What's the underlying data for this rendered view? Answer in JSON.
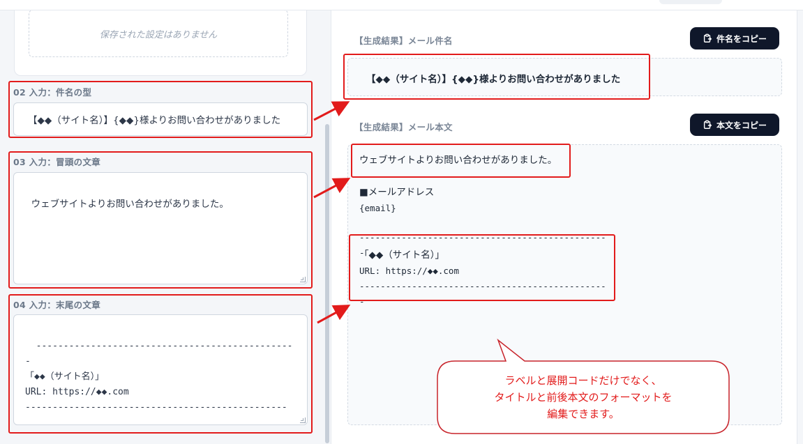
{
  "left": {
    "saved_empty": "保存された設定はありません",
    "fields": [
      {
        "label": "02 入力：件名の型",
        "value": "【◆◆（サイト名）】{◆◆}様よりお問い合わせがありました"
      },
      {
        "label": "03 入力：冒頭の文章",
        "value": "ウェブサイトよりお問い合わせがありました。"
      },
      {
        "label": "04 入力：末尾の文章",
        "value": "------------------------------------------------\n「◆◆（サイト名）」\nURL: https://◆◆.com\n------------------------------------------------"
      }
    ]
  },
  "right": {
    "subject_label": "【生成結果】メール件名",
    "subject_copy": "件名をコピー",
    "subject_value": "【◆◆（サイト名）】{◆◆}様よりお問い合わせがありました",
    "body_label": "【生成結果】メール本文",
    "body_copy": "本文をコピー",
    "body_intro": "ウェブサイトよりお問い合わせがありました。",
    "body_field_label": "■メールアドレス",
    "body_field_value": "{email}",
    "body_divider": "------------------------------------------------",
    "body_site_name": "「◆◆（サイト名）」",
    "body_url": "URL: https://◆◆.com"
  },
  "callout": {
    "lines": [
      "ラベルと展開コードだけでなく、",
      "タイトルと前後本文のフォーマットを",
      "編集できます。"
    ]
  },
  "colors": {
    "annotation_red": "#e21b1b",
    "button_dark": "#0f172a",
    "label_gray": "#6b7889"
  },
  "icons": {
    "copy": "clipboard-copy-icon"
  }
}
